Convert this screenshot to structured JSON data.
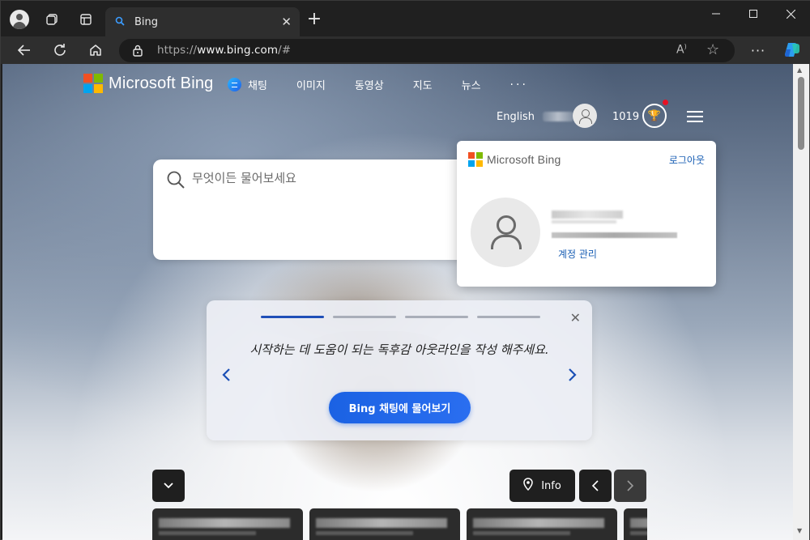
{
  "browser": {
    "tab_title": "Bing",
    "tab_favicon": "search-icon",
    "url_prefix": "https://",
    "url_domain": "www.bing.com",
    "url_suffix": "/#"
  },
  "bing": {
    "logo_text": "Microsoft Bing",
    "nav": [
      {
        "label": "채팅",
        "icon": "chat-icon"
      },
      {
        "label": "이미지"
      },
      {
        "label": "동영상"
      },
      {
        "label": "지도"
      },
      {
        "label": "뉴스"
      },
      {
        "label": "···"
      }
    ],
    "language_link": "English",
    "points": "1019",
    "search_placeholder": "무엇이든 물어보세요"
  },
  "account_panel": {
    "logo_text": "Microsoft Bing",
    "signout_label": "로그아웃",
    "manage_label": "계정 관리"
  },
  "tip_card": {
    "steps_total": 4,
    "active_step": 1,
    "text": "시작하는 데 도움이 되는 독후감 아웃라인을 작성 해주세요.",
    "button_label": "Bing 채팅에 물어보기"
  },
  "bottom": {
    "info_label": "Info"
  },
  "colors": {
    "accent": "#1b62e3",
    "link": "#1a5fb4",
    "notification": "#e81123"
  }
}
